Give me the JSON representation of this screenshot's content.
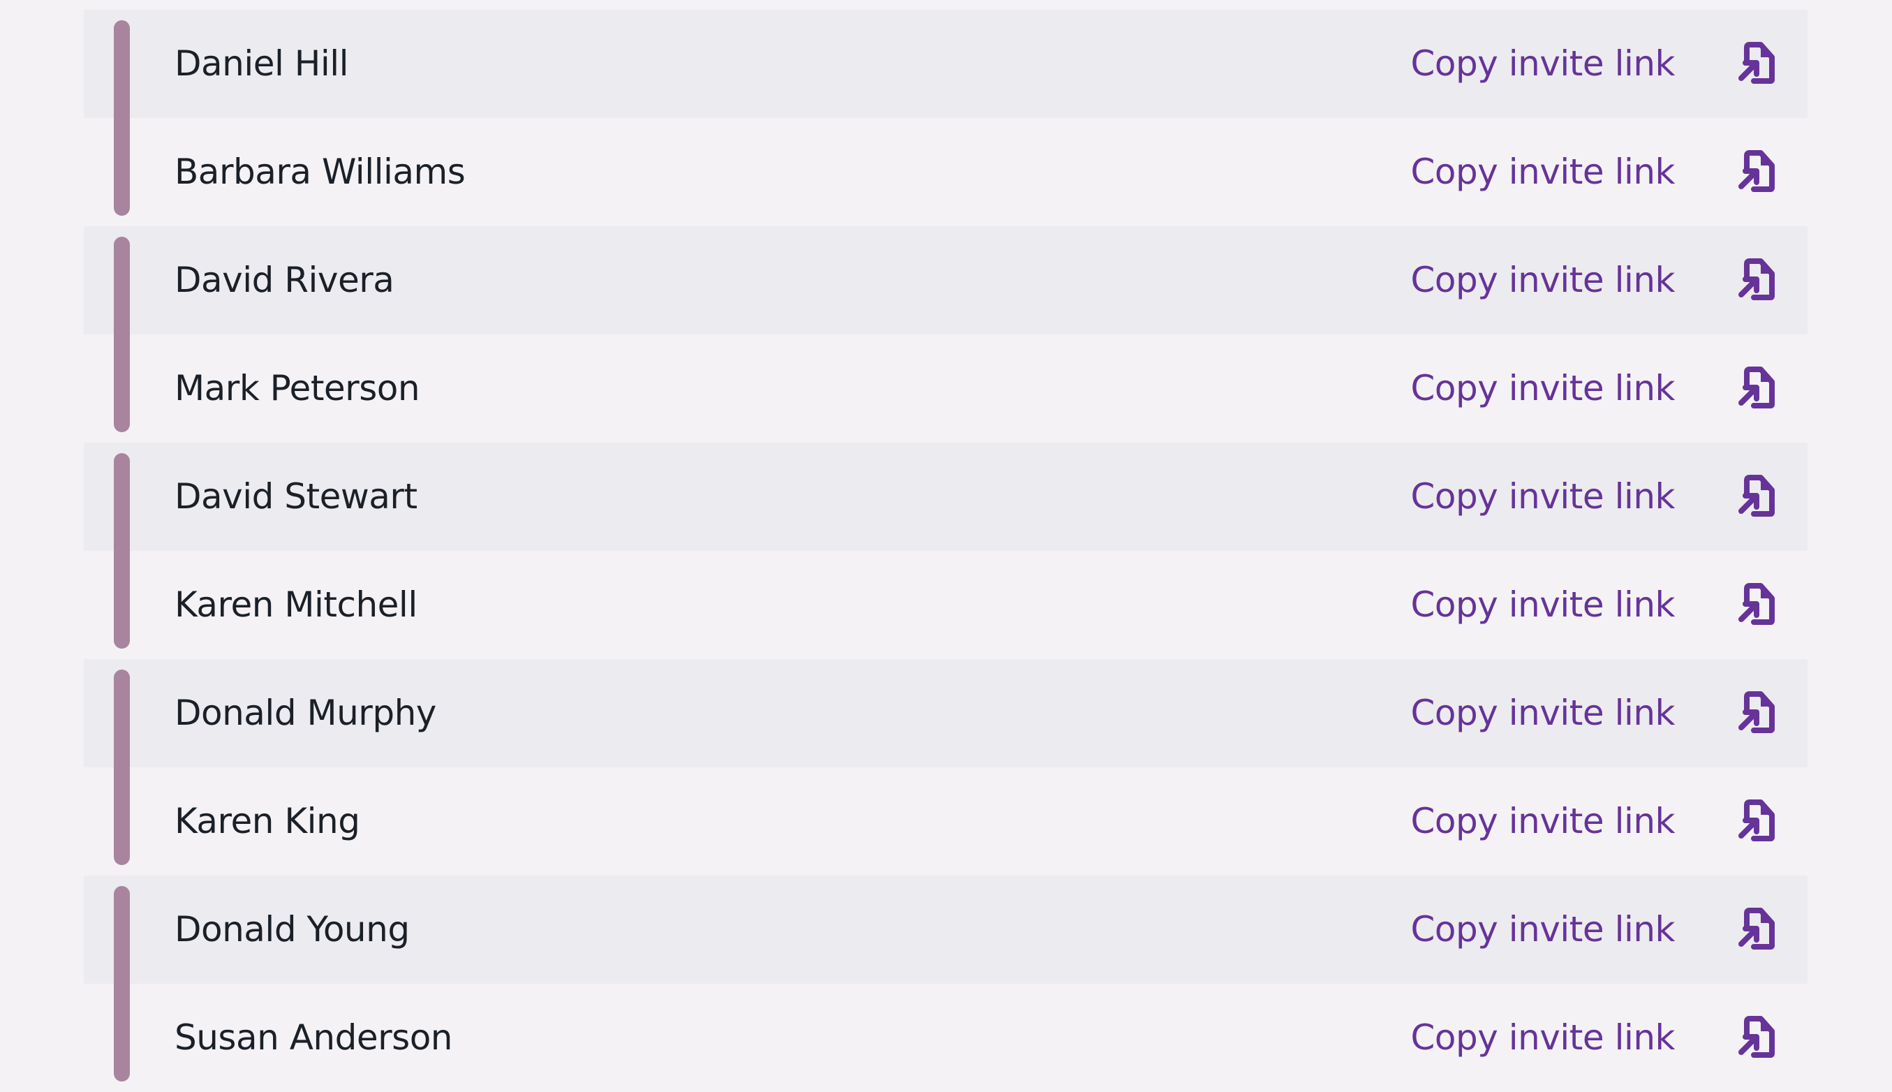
{
  "colors": {
    "page_background": "#F4F2F5",
    "row_shaded": "#ECEBEF",
    "group_bar": "#A8849F",
    "name_text": "#1B2028",
    "accent": "#663399"
  },
  "invitees": [
    {
      "name": "Daniel Hill",
      "action_label": "Copy invite link",
      "action_icon": "copy-link-document-icon"
    },
    {
      "name": "Barbara Williams",
      "action_label": "Copy invite link",
      "action_icon": "copy-link-document-icon"
    },
    {
      "name": "David Rivera",
      "action_label": "Copy invite link",
      "action_icon": "copy-link-document-icon"
    },
    {
      "name": "Mark Peterson",
      "action_label": "Copy invite link",
      "action_icon": "copy-link-document-icon"
    },
    {
      "name": "David Stewart",
      "action_label": "Copy invite link",
      "action_icon": "copy-link-document-icon"
    },
    {
      "name": "Karen Mitchell",
      "action_label": "Copy invite link",
      "action_icon": "copy-link-document-icon"
    },
    {
      "name": "Donald Murphy",
      "action_label": "Copy invite link",
      "action_icon": "copy-link-document-icon"
    },
    {
      "name": "Karen King",
      "action_label": "Copy invite link",
      "action_icon": "copy-link-document-icon"
    },
    {
      "name": "Donald Young",
      "action_label": "Copy invite link",
      "action_icon": "copy-link-document-icon"
    },
    {
      "name": "Susan Anderson",
      "action_label": "Copy invite link",
      "action_icon": "copy-link-document-icon"
    }
  ]
}
